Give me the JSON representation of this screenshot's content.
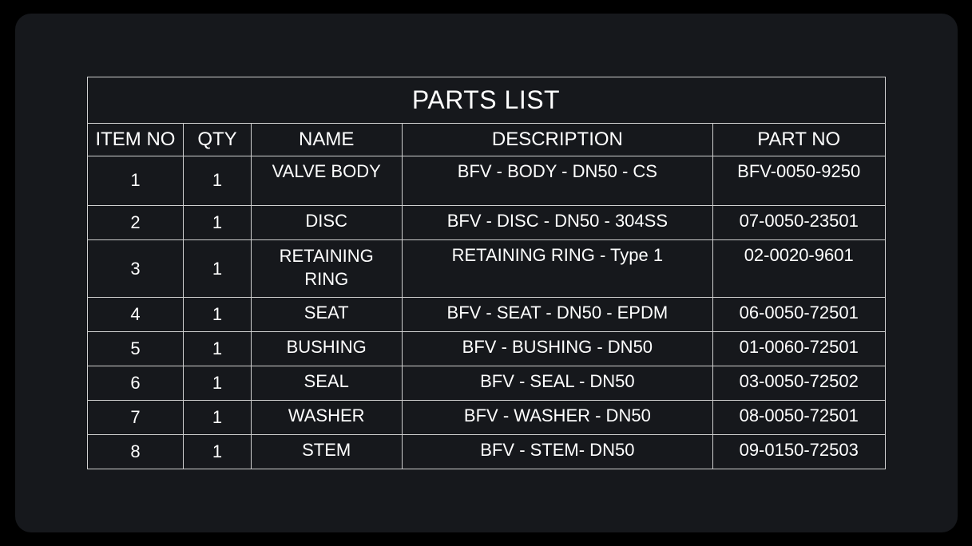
{
  "title": "PARTS LIST",
  "headers": {
    "item_no": "ITEM NO",
    "qty": "QTY",
    "name": "NAME",
    "description": "DESCRIPTION",
    "part_no": "PART NO"
  },
  "rows": [
    {
      "item_no": "1",
      "qty": "1",
      "name": "VALVE BODY",
      "description": "BFV - BODY - DN50 - CS",
      "part_no": "BFV-0050-9250",
      "tall": true
    },
    {
      "item_no": "2",
      "qty": "1",
      "name": "DISC",
      "description": "BFV - DISC - DN50 - 304SS",
      "part_no": "07-0050-23501"
    },
    {
      "item_no": "3",
      "qty": "1",
      "name": "RETAINING RING",
      "description": "RETAINING RING - Type 1",
      "part_no": "02-0020-9601",
      "tall": true,
      "name_two_line": true
    },
    {
      "item_no": "4",
      "qty": "1",
      "name": "SEAT",
      "description": "BFV - SEAT - DN50 - EPDM",
      "part_no": "06-0050-72501"
    },
    {
      "item_no": "5",
      "qty": "1",
      "name": "BUSHING",
      "description": "BFV - BUSHING - DN50",
      "part_no": "01-0060-72501"
    },
    {
      "item_no": "6",
      "qty": "1",
      "name": "SEAL",
      "description": "BFV - SEAL - DN50",
      "part_no": "03-0050-72502"
    },
    {
      "item_no": "7",
      "qty": "1",
      "name": "WASHER",
      "description": "BFV - WASHER - DN50",
      "part_no": "08-0050-72501"
    },
    {
      "item_no": "8",
      "qty": "1",
      "name": "STEM",
      "description": "BFV - STEM- DN50",
      "part_no": "09-0150-72503"
    }
  ]
}
